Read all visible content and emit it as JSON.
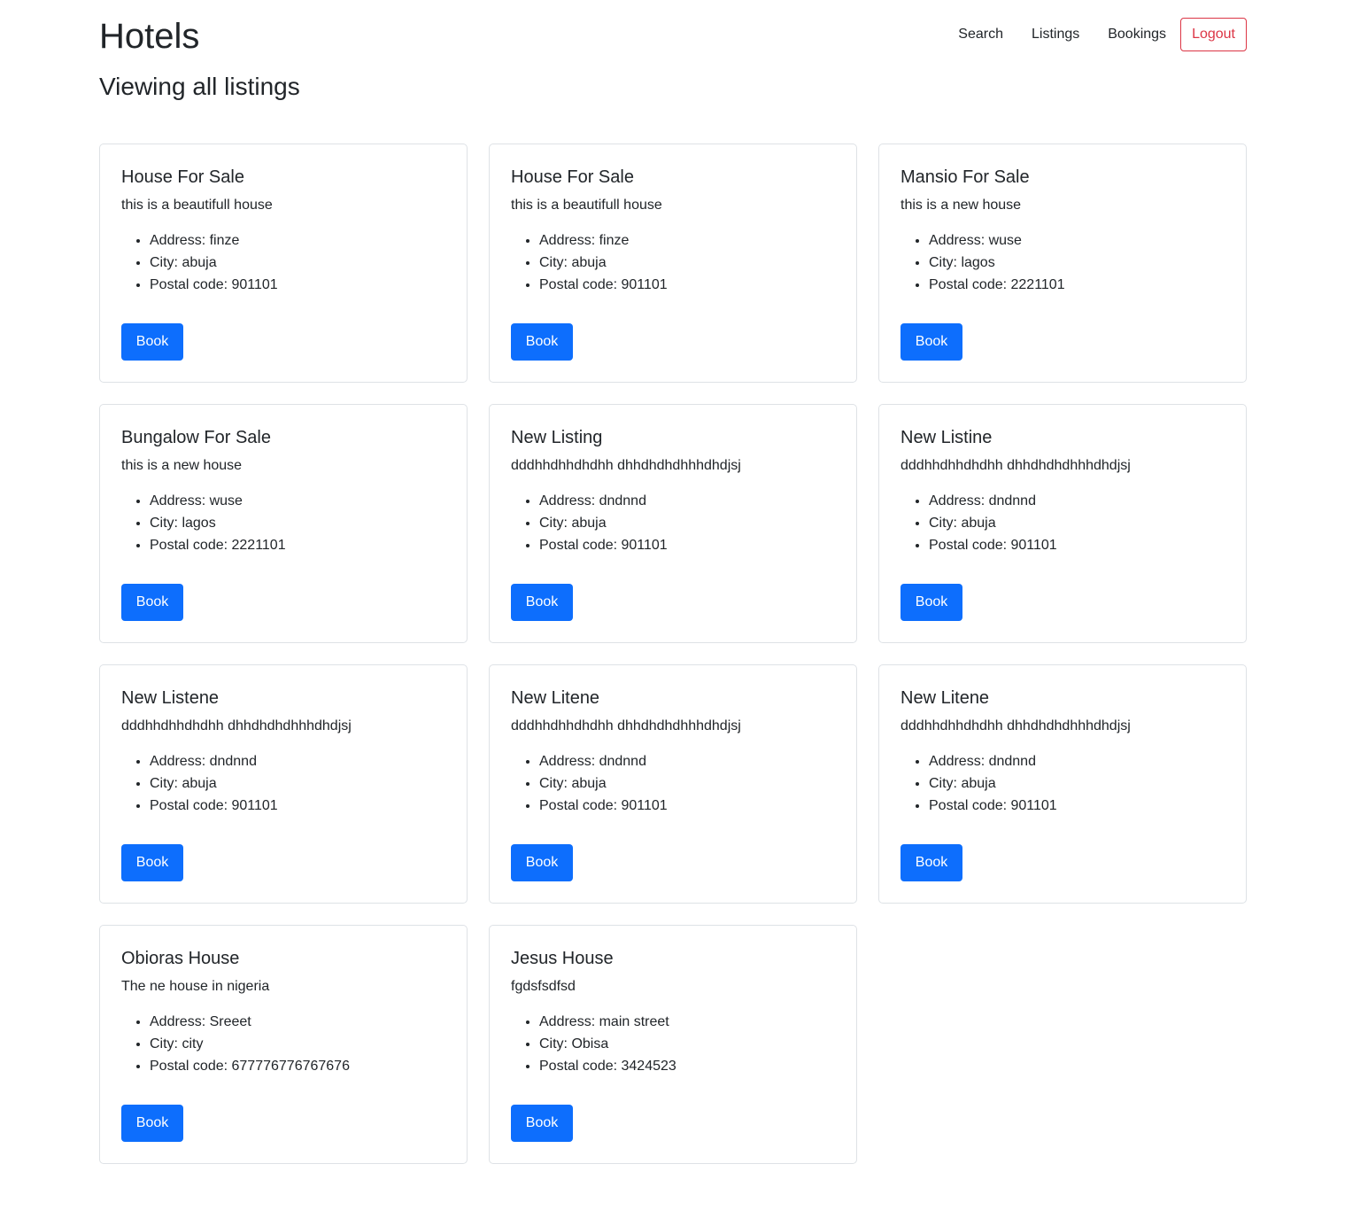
{
  "header": {
    "brand": "Hotels",
    "nav": [
      "Search",
      "Listings",
      "Bookings"
    ],
    "logout_label": "Logout"
  },
  "page_title": "Viewing all listings",
  "colors": {
    "primary": "#0d6efd",
    "danger": "#dc3545",
    "border": "#dee2e6",
    "text": "#212529"
  },
  "listings": [
    {
      "title": "House For Sale",
      "description": "this is a beautifull house",
      "address": "Address: finze",
      "city": "City: abuja",
      "postal": "Postal code: 901101",
      "button": "Book"
    },
    {
      "title": "House For Sale",
      "description": "this is a beautifull house",
      "address": "Address: finze",
      "city": "City: abuja",
      "postal": "Postal code: 901101",
      "button": "Book"
    },
    {
      "title": "Mansio For Sale",
      "description": "this is a new house",
      "address": "Address: wuse",
      "city": "City: lagos",
      "postal": "Postal code: 2221101",
      "button": "Book"
    },
    {
      "title": "Bungalow For Sale",
      "description": "this is a new house",
      "address": "Address: wuse",
      "city": "City: lagos",
      "postal": "Postal code: 2221101",
      "button": "Book"
    },
    {
      "title": "New Listing",
      "description": "dddhhdhhdhdhh dhhdhdhdhhhdhdjsj",
      "address": "Address: dndnnd",
      "city": "City: abuja",
      "postal": "Postal code: 901101",
      "button": "Book"
    },
    {
      "title": "New Listine",
      "description": "dddhhdhhdhdhh dhhdhdhdhhhdhdjsj",
      "address": "Address: dndnnd",
      "city": "City: abuja",
      "postal": "Postal code: 901101",
      "button": "Book"
    },
    {
      "title": "New Listene",
      "description": "dddhhdhhdhdhh dhhdhdhdhhhdhdjsj",
      "address": "Address: dndnnd",
      "city": "City: abuja",
      "postal": "Postal code: 901101",
      "button": "Book"
    },
    {
      "title": "New Litene",
      "description": "dddhhdhhdhdhh dhhdhdhdhhhdhdjsj",
      "address": "Address: dndnnd",
      "city": "City: abuja",
      "postal": "Postal code: 901101",
      "button": "Book"
    },
    {
      "title": "New Litene",
      "description": "dddhhdhhdhdhh dhhdhdhdhhhdhdjsj",
      "address": "Address: dndnnd",
      "city": "City: abuja",
      "postal": "Postal code: 901101",
      "button": "Book"
    },
    {
      "title": "Obioras House",
      "description": "The ne house in nigeria",
      "address": "Address: Sreeet",
      "city": "City: city",
      "postal": "Postal code: 677776776767676",
      "button": "Book"
    },
    {
      "title": "Jesus House",
      "description": "fgdsfsdfsd",
      "address": "Address: main street",
      "city": "City: Obisa",
      "postal": "Postal code: 3424523",
      "button": "Book"
    }
  ]
}
